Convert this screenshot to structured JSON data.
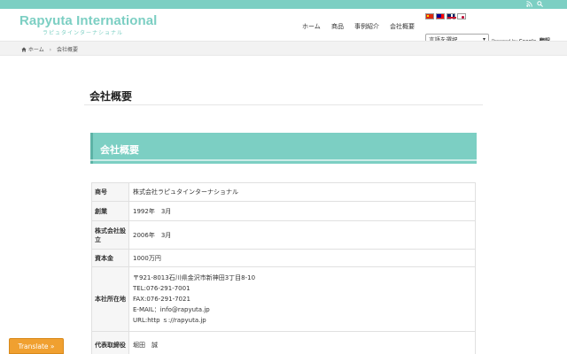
{
  "logo": {
    "main": "Rapyuta International",
    "sub": "ラピュタインターナショナル"
  },
  "topbar": {
    "rss_icon": "rss-icon",
    "search_icon": "search-icon"
  },
  "nav": {
    "items": [
      "ホーム",
      "商品",
      "事例紹介",
      "会社概要"
    ]
  },
  "translate_widget": {
    "flags": [
      "flag-cn",
      "flag-tw",
      "flag-gb",
      "flag-jp"
    ],
    "select_value": "言語を選択",
    "powered_by": "Powered by",
    "google": "Google",
    "translate": "翻訳"
  },
  "breadcrumb": {
    "home": "ホーム",
    "current": "会社概要"
  },
  "page": {
    "title": "会社概要",
    "section_title": "会社概要"
  },
  "table": {
    "rows": [
      {
        "label": "商号",
        "lines": [
          "株式会社ラピュタインターナショナル"
        ]
      },
      {
        "label": "創業",
        "lines": [
          "1992年　3月"
        ]
      },
      {
        "label": "株式会社設立",
        "lines": [
          "2006年　3月"
        ]
      },
      {
        "label": "資本金",
        "lines": [
          "1000万円"
        ]
      },
      {
        "label": "本社所在地",
        "lines": [
          "〒921-8013石川県金沢市新神田3丁目8-10",
          "TEL:076-291-7001",
          "FAX:076-291-7021",
          "E-MAIL：info@rapyuta.jp",
          "URL:http ｓ://rapyuta.jp"
        ]
      },
      {
        "label": "代表取締役",
        "lines": [
          "堀田　誠"
        ]
      }
    ]
  },
  "translate_button": "Translate »",
  "colors": {
    "accent": "#7ccfc3",
    "translate_button": "#f0a030"
  }
}
